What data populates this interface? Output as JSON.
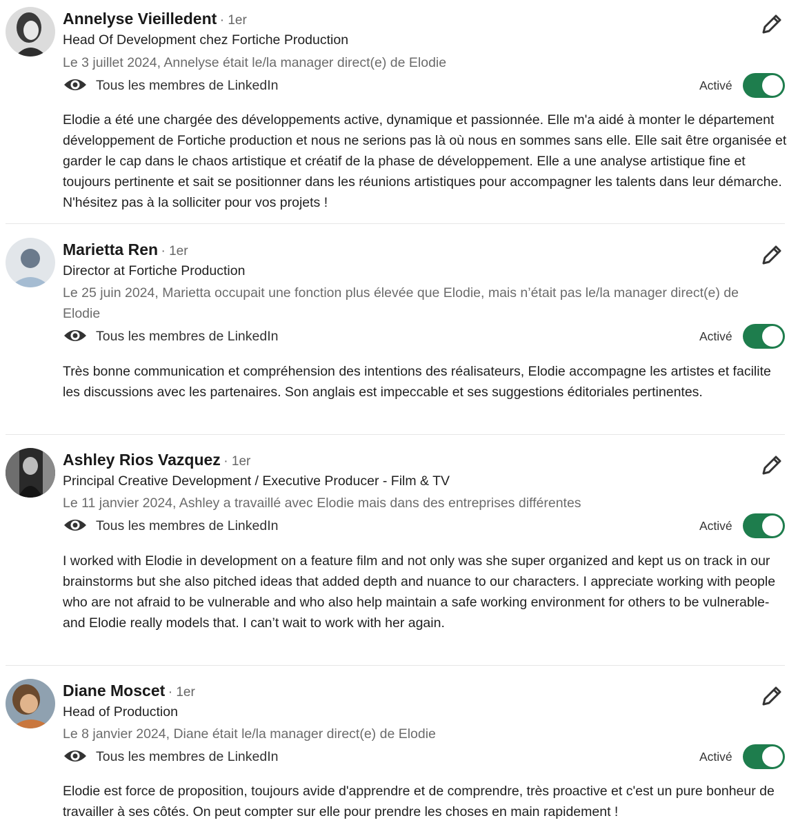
{
  "recommendations": [
    {
      "name": "Annelyse Vieilledent",
      "degree": "· 1er",
      "headline": "Head Of Development chez Fortiche Production",
      "relation": "Le 3 juillet 2024, Annelyse était le/la manager direct(e) de Elodie",
      "visibility": "Tous les membres de LinkedIn",
      "status": "Activé",
      "text": "Elodie a été une chargée des développements active, dynamique et passionnée. Elle m'a aidé à monter le département développement de Fortiche production et nous ne serions pas là où nous en sommes sans elle. Elle sait être organisée et garder le cap dans le chaos artistique et créatif de la phase de développement. Elle a une analyse artistique fine et toujours pertinente et sait se positionner dans les réunions artistiques pour accompagner les talents dans leur démarche. N'hésitez pas à la solliciter pour vos projets !"
    },
    {
      "name": "Marietta Ren",
      "degree": "· 1er",
      "headline": "Director at Fortiche Production",
      "relation": "Le 25 juin 2024, Marietta occupait une fonction plus élevée que Elodie, mais n’était pas le/la manager direct(e) de Elodie",
      "visibility": "Tous les membres de LinkedIn",
      "status": "Activé",
      "text": "Très bonne communication et compréhension des intentions des réalisateurs, Elodie accompagne les artistes et facilite les discussions avec les partenaires. Son anglais est impeccable et ses suggestions éditoriales pertinentes."
    },
    {
      "name": "Ashley Rios Vazquez",
      "degree": "· 1er",
      "headline": "Principal Creative Development / Executive Producer - Film & TV",
      "relation": "Le 11 janvier 2024, Ashley a travaillé avec Elodie mais dans des entreprises différentes",
      "visibility": "Tous les membres de LinkedIn",
      "status": "Activé",
      "text": "I worked with Elodie in development on a feature film and not only was she super organized and kept us on track in our brainstorms but she also pitched ideas that added depth and nuance to our characters. I appreciate working with people who are not afraid to be vulnerable and who also help maintain a safe working environment for others to be vulnerable- and Elodie really models that. I can’t wait to work with her again."
    },
    {
      "name": "Diane Moscet",
      "degree": "· 1er",
      "headline": "Head of Production",
      "relation": "Le 8 janvier 2024, Diane était le/la manager direct(e) de Elodie",
      "visibility": "Tous les membres de LinkedIn",
      "status": "Activé",
      "text": "Elodie est force de proposition, toujours avide d'apprendre et de comprendre, très proactive et c'est un pure bonheur de travailler à ses côtés. On peut compter sur elle pour prendre les choses en main rapidement !"
    }
  ],
  "icons": {
    "visibility": "eye-icon",
    "edit": "pencil-icon"
  },
  "colors": {
    "toggle_on": "#1e7d4d",
    "secondary_text": "#6b6b6b"
  }
}
